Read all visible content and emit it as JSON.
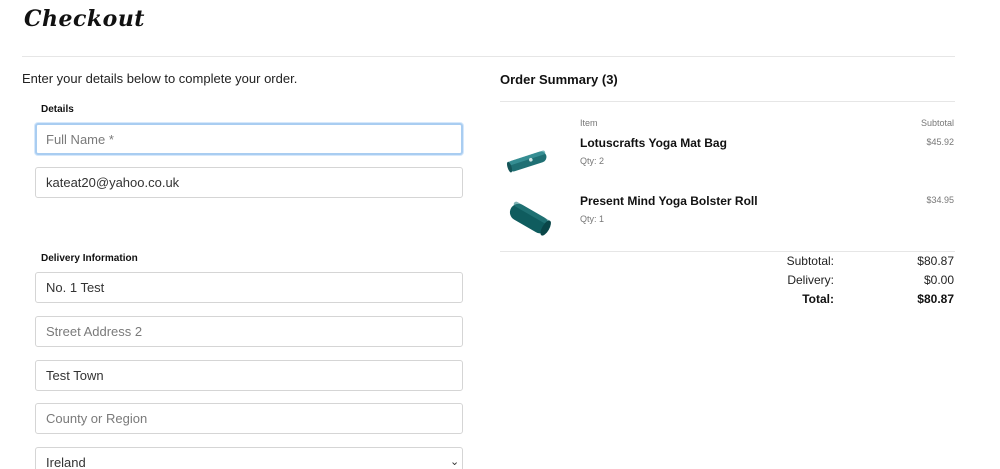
{
  "page": {
    "title": "Checkout",
    "intro": "Enter your details below to complete your order."
  },
  "details": {
    "label": "Details",
    "full_name": {
      "value": "",
      "placeholder": "Full Name *"
    },
    "email": {
      "value": "kateat20@yahoo.co.uk",
      "placeholder": ""
    }
  },
  "delivery": {
    "label": "Delivery Information",
    "address1": {
      "value": "No. 1 Test",
      "placeholder": ""
    },
    "address2": {
      "value": "",
      "placeholder": "Street Address 2"
    },
    "town": {
      "value": "Test Town",
      "placeholder": ""
    },
    "county": {
      "value": "",
      "placeholder": "County or Region"
    },
    "country": {
      "selected": "Ireland"
    }
  },
  "summary": {
    "title": "Order Summary (3)",
    "col_item": "Item",
    "col_subtotal": "Subtotal",
    "items": [
      {
        "name": "Lotuscrafts Yoga Mat Bag",
        "qty": "Qty: 2",
        "price": "$45.92",
        "image_icon": "yoga-mat-bag-image"
      },
      {
        "name": "Present Mind Yoga Bolster Roll",
        "qty": "Qty: 1",
        "price": "$34.95",
        "image_icon": "bolster-roll-image"
      }
    ],
    "subtotal_label": "Subtotal:",
    "subtotal_value": "$80.87",
    "delivery_label": "Delivery:",
    "delivery_value": "$0.00",
    "total_label": "Total:",
    "total_value": "$80.87"
  },
  "colors": {
    "accent_focus": "#a9cdf1",
    "product_teal": "#0f5c5e"
  }
}
